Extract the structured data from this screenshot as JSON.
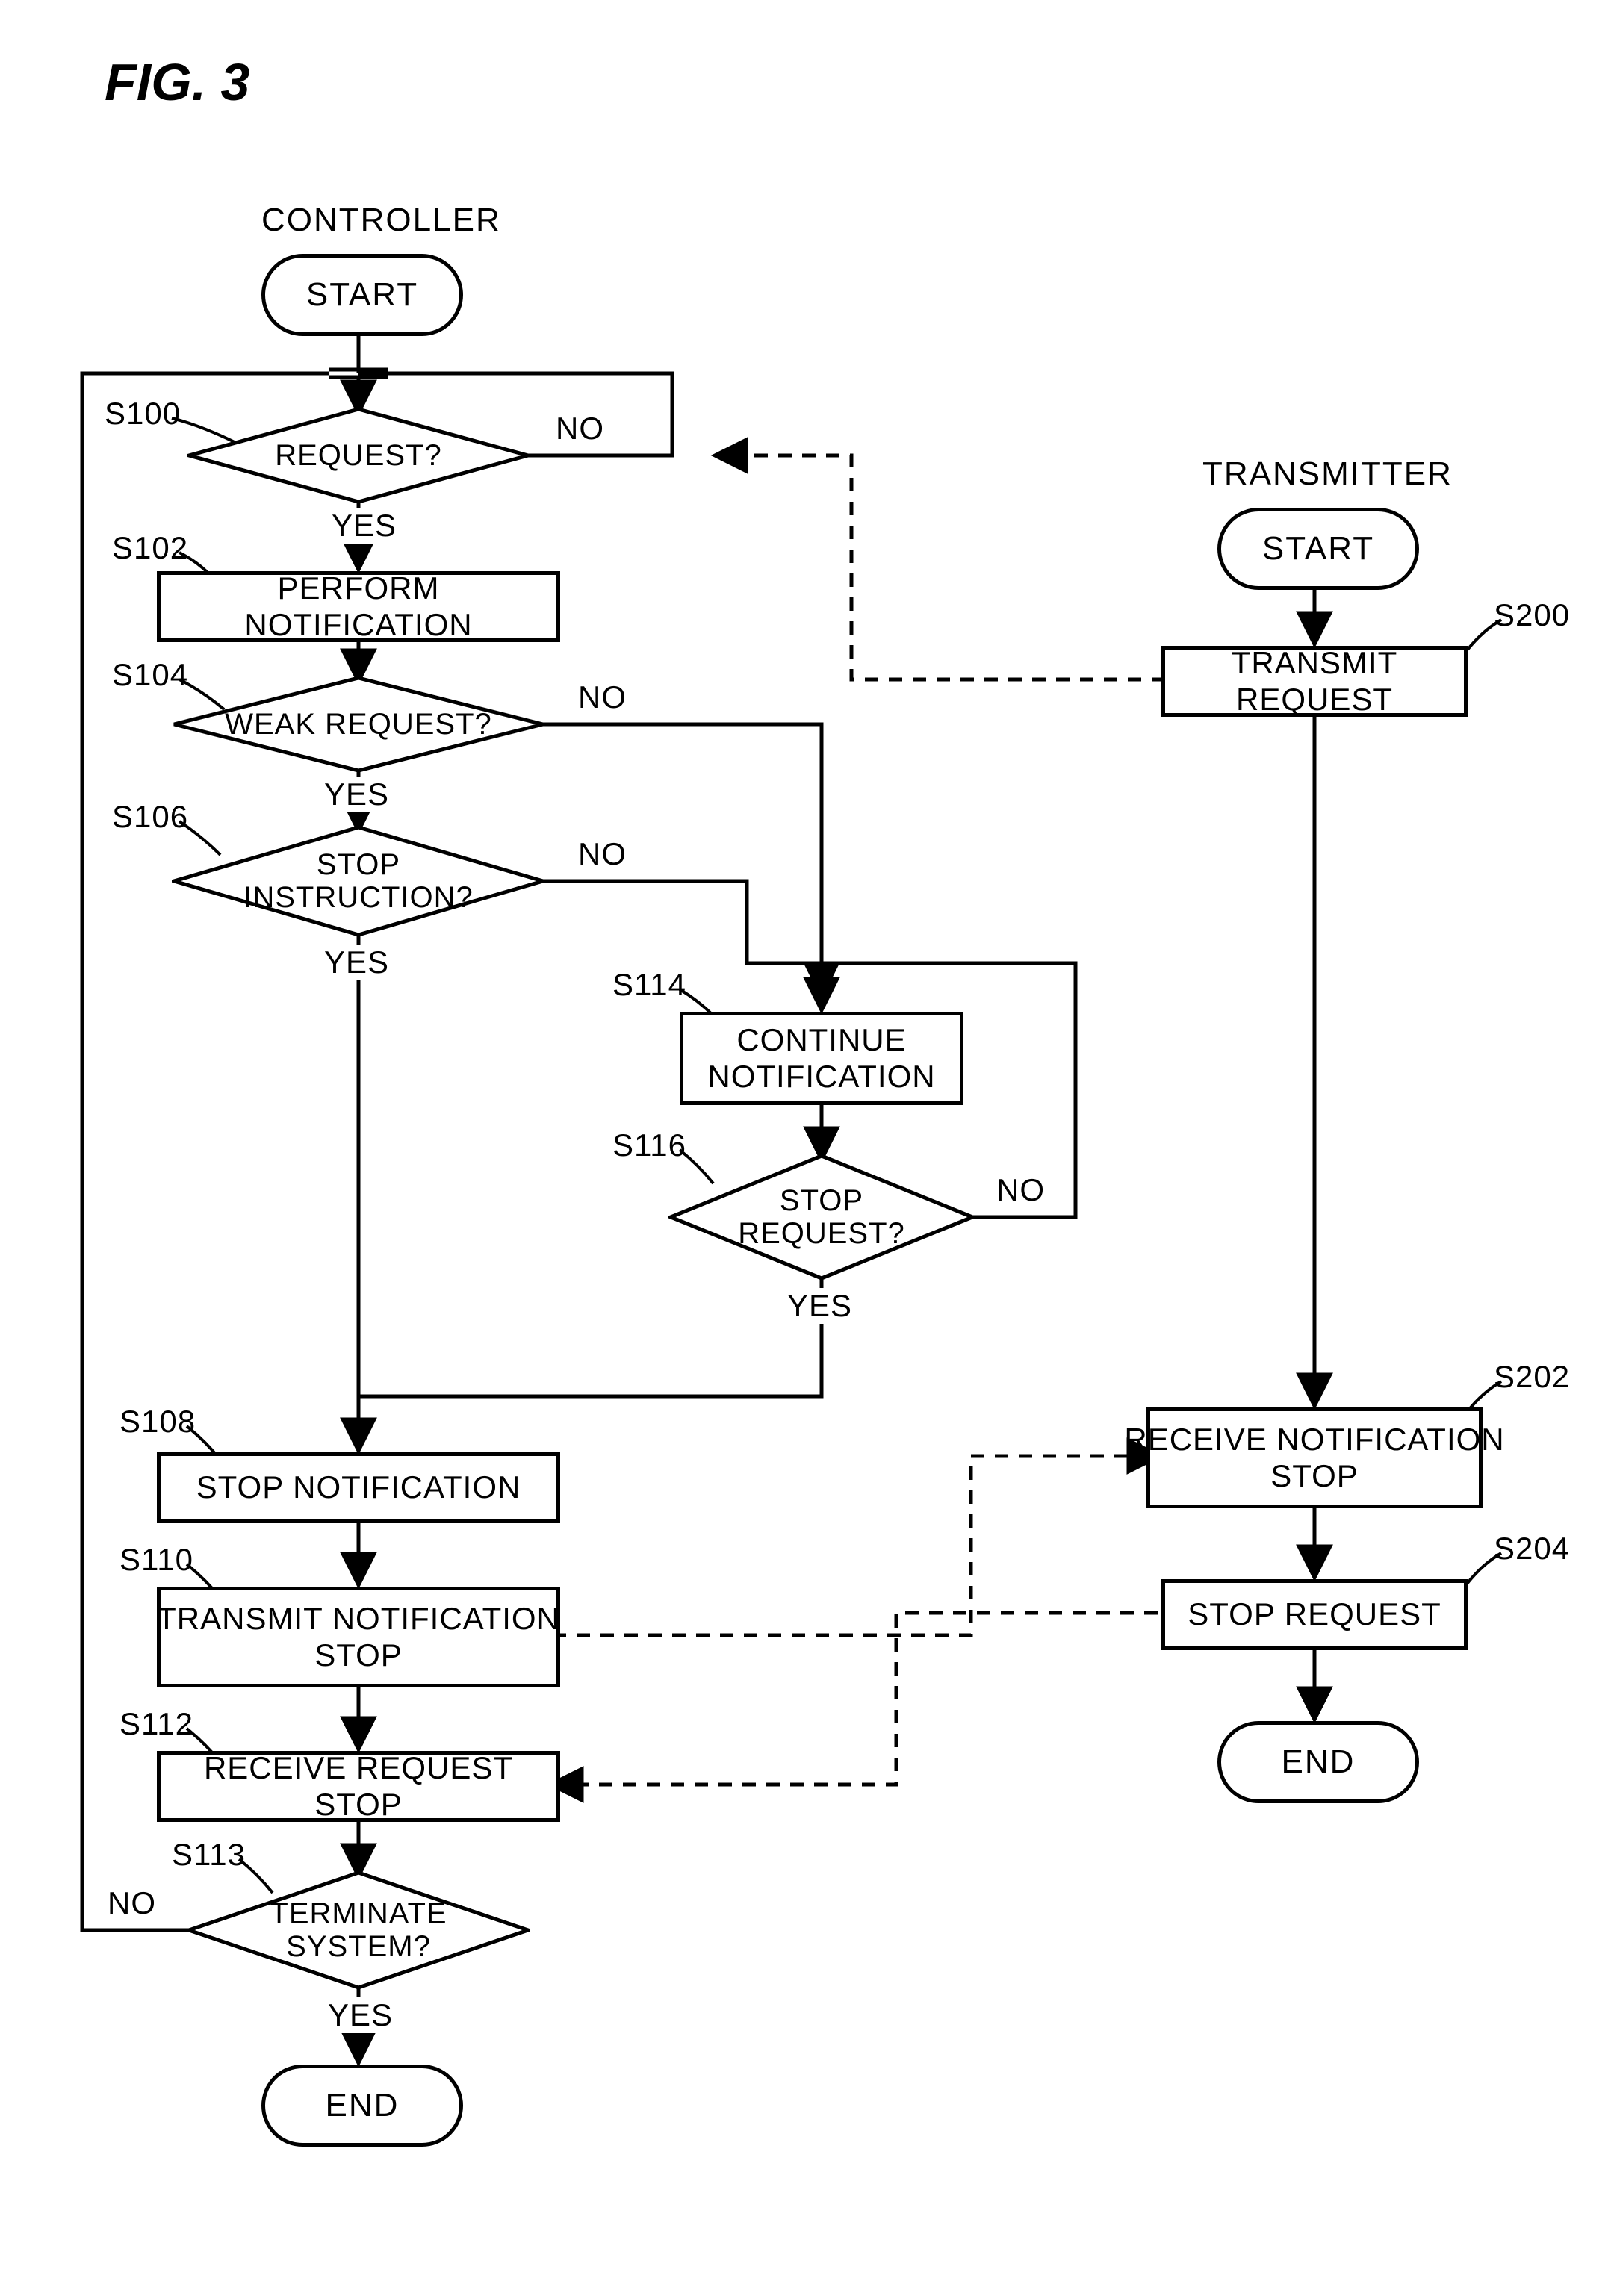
{
  "figure_title": "FIG. 3",
  "controller": {
    "heading": "CONTROLLER",
    "start": "START",
    "end": "END",
    "s100": {
      "id": "S100",
      "text": "REQUEST?",
      "yes": "YES",
      "no": "NO"
    },
    "s102": {
      "id": "S102",
      "text": "PERFORM NOTIFICATION"
    },
    "s104": {
      "id": "S104",
      "text": "WEAK REQUEST?",
      "yes": "YES",
      "no": "NO"
    },
    "s106": {
      "id": "S106",
      "text": "STOP\nINSTRUCTION?",
      "yes": "YES",
      "no": "NO"
    },
    "s108": {
      "id": "S108",
      "text": "STOP NOTIFICATION"
    },
    "s110": {
      "id": "S110",
      "text": "TRANSMIT NOTIFICATION\nSTOP"
    },
    "s112": {
      "id": "S112",
      "text": "RECEIVE REQUEST STOP"
    },
    "s113": {
      "id": "S113",
      "text": "TERMINATE\nSYSTEM?",
      "yes": "YES",
      "no": "NO"
    },
    "s114": {
      "id": "S114",
      "text": "CONTINUE\nNOTIFICATION"
    },
    "s116": {
      "id": "S116",
      "text": "STOP\nREQUEST?",
      "yes": "YES",
      "no": "NO"
    }
  },
  "transmitter": {
    "heading": "TRANSMITTER",
    "start": "START",
    "end": "END",
    "s200": {
      "id": "S200",
      "text": "TRANSMIT REQUEST"
    },
    "s202": {
      "id": "S202",
      "text": "RECEIVE NOTIFICATION\nSTOP"
    },
    "s204": {
      "id": "S204",
      "text": "STOP REQUEST"
    }
  }
}
